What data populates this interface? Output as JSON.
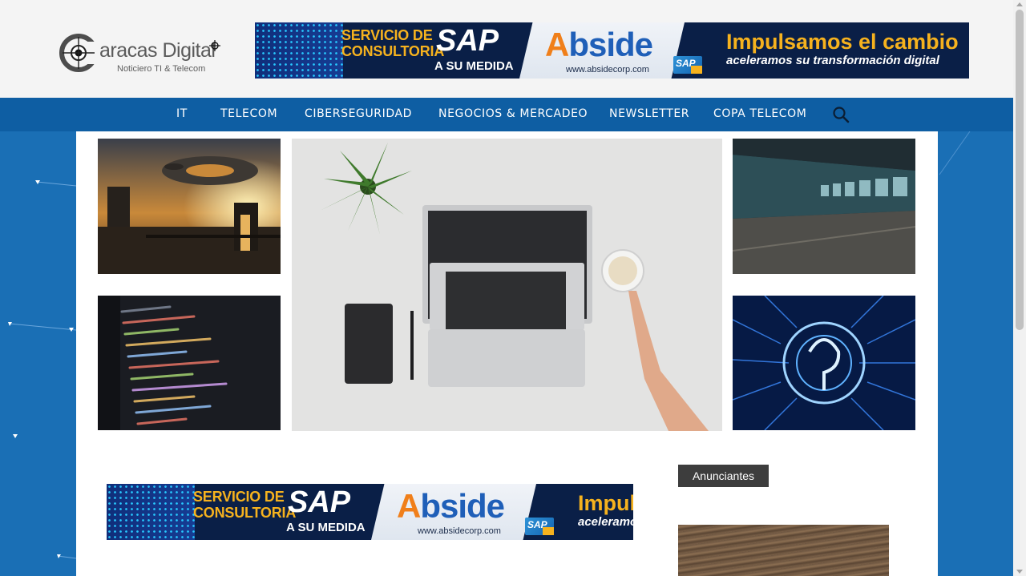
{
  "site": {
    "logo_title": "aracas Digital",
    "logo_subtitle": "Noticiero TI & Telecom"
  },
  "nav": {
    "items": [
      {
        "label": "IT"
      },
      {
        "label": "TELECOM"
      },
      {
        "label": "CIBERSEGURIDAD"
      },
      {
        "label": "NEGOCIOS & MERCADEO"
      },
      {
        "label": "NEWSLETTER"
      },
      {
        "label": "COPA TELECOM"
      }
    ],
    "search_icon": "search-icon"
  },
  "ad": {
    "line1": "SERVICIO DE",
    "line2": "CONSULTORIA",
    "sap": "SAP",
    "medida": "A SU MEDIDA",
    "brand_a": "A",
    "brand_rest": "bside",
    "url": "www.absidecorp.com",
    "badge": "SAP",
    "headline": "Impulsamos el cambio",
    "headline_short": "Impuls",
    "tagline": "aceleramos su transformación digital",
    "tagline_short": "aceleramo"
  },
  "sidebar": {
    "heading": "Anunciantes"
  },
  "colors": {
    "nav_bg": "#0e5ea3",
    "page_bg": "#1a6fb5",
    "ad_orange": "#f6b21e"
  }
}
